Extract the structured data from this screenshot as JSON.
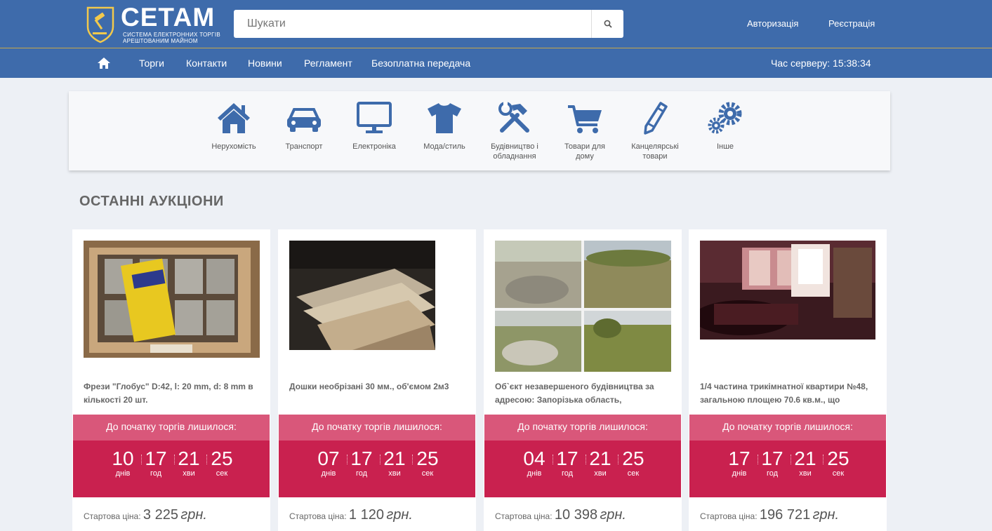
{
  "header": {
    "logo_title": "СЕТАМ",
    "logo_sub_line1": "система електронних торгів",
    "logo_sub_line2": "арештованим майном",
    "search_placeholder": "Шукати",
    "login": "Авторизація",
    "register": "Реєстрація"
  },
  "nav": {
    "items": [
      "Торги",
      "Контакти",
      "Новини",
      "Регламент",
      "Безоплатна передача"
    ],
    "server_time": "Час серверу: 15:38:34"
  },
  "categories": [
    {
      "icon": "house-icon",
      "line1": "Нерухомість",
      "line2": ""
    },
    {
      "icon": "car-icon",
      "line1": "Транспорт",
      "line2": ""
    },
    {
      "icon": "monitor-icon",
      "line1": "Електроніка",
      "line2": ""
    },
    {
      "icon": "tshirt-icon",
      "line1": "Мода/стиль",
      "line2": ""
    },
    {
      "icon": "tools-icon",
      "line1": "Будівництво і",
      "line2": "обладнання"
    },
    {
      "icon": "cart-icon",
      "line1": "Товари для",
      "line2": "дому"
    },
    {
      "icon": "pencil-icon",
      "line1": "Канцелярські",
      "line2": "товари"
    },
    {
      "icon": "gears-icon",
      "line1": "Інше",
      "line2": ""
    }
  ],
  "section_title": "ОСТАННІ АУКЦІОНИ",
  "countdown_labels": {
    "title": "До початку торгів лишилося:",
    "days": "днів",
    "hours": "год",
    "minutes": "хви",
    "seconds": "сек"
  },
  "price_label": "Стартова ціна:",
  "currency": "грн.",
  "auctions": [
    {
      "title": "Фрези \"Глобус\" D:42, l: 20 mm, d: 8 mm в кількості 20 шт.",
      "days": "10",
      "hours": "17",
      "minutes": "21",
      "seconds": "25",
      "price": "3 225"
    },
    {
      "title": "Дошки необрізані 30 мм., об'ємом 2м3",
      "days": "07",
      "hours": "17",
      "minutes": "21",
      "seconds": "25",
      "price": "1 120"
    },
    {
      "title": "Об`єкт незавершеного будівництва за адресою: Запорізька область,",
      "days": "04",
      "hours": "17",
      "minutes": "21",
      "seconds": "25",
      "price": "10 398"
    },
    {
      "title": "1/4 частина трикімнатної квартири №48, загальною площею 70.6 кв.м., що",
      "days": "17",
      "hours": "17",
      "minutes": "21",
      "seconds": "25",
      "price": "196 721"
    }
  ],
  "colors": {
    "header": "#3e6bab",
    "icon": "#3e6bab",
    "countdown_head": "#d9577a",
    "countdown_body": "#c9214f"
  }
}
